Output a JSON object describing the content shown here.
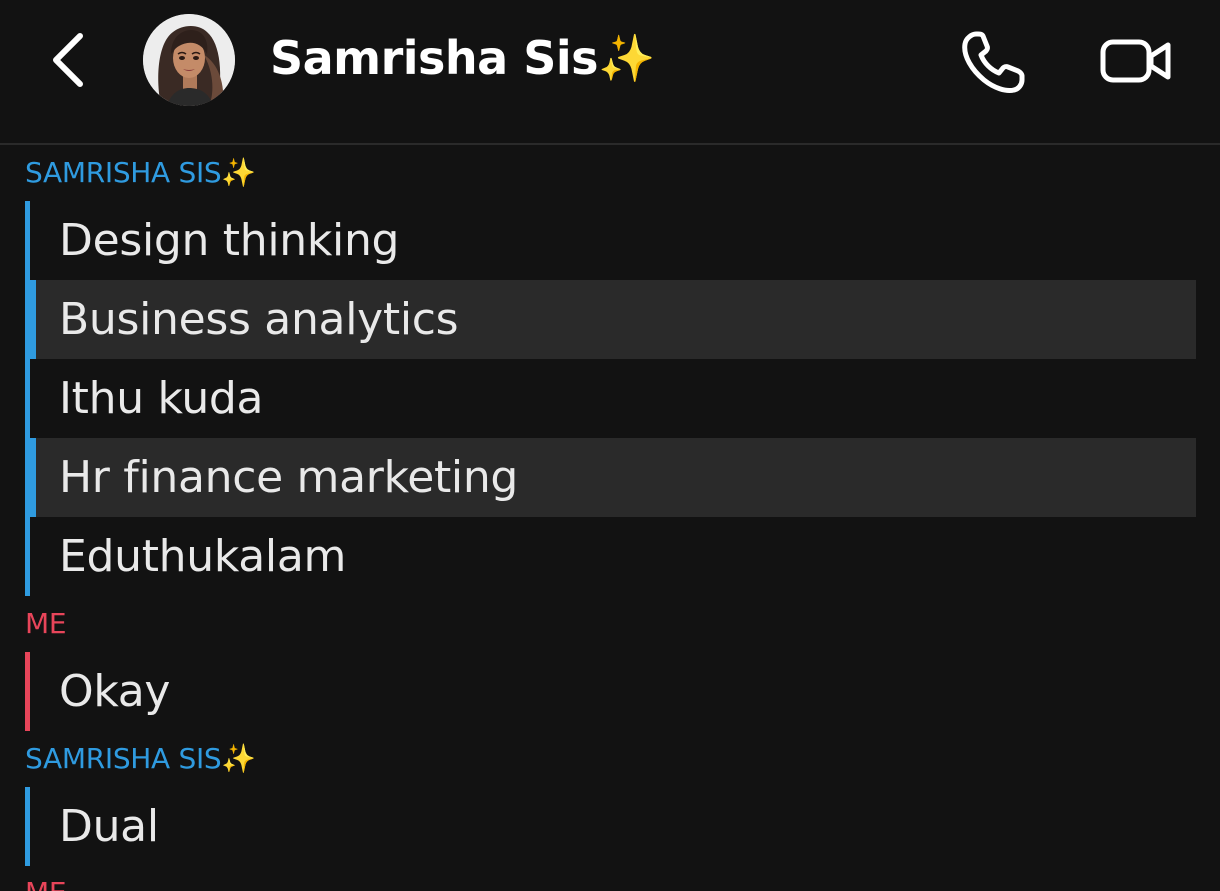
{
  "header": {
    "contact_name": "Samrisha Sis✨",
    "back_icon": "chevron-left-icon",
    "call_icon": "phone-icon",
    "video_icon": "video-camera-icon"
  },
  "colors": {
    "background": "#121212",
    "them_accent": "#2f9be0",
    "me_accent": "#e8455a",
    "highlight_bg": "#2a2a2a",
    "text": "#e9e9e9"
  },
  "conversation": [
    {
      "sender": "SAMRISHA SIS✨",
      "side": "them",
      "messages": [
        {
          "text": "Design thinking",
          "highlighted": false
        },
        {
          "text": "Business analytics",
          "highlighted": true
        },
        {
          "text": "Ithu kuda",
          "highlighted": false
        },
        {
          "text": "Hr finance marketing",
          "highlighted": true
        },
        {
          "text": "Eduthukalam",
          "highlighted": false
        }
      ]
    },
    {
      "sender": "ME",
      "side": "me",
      "messages": [
        {
          "text": "Okay",
          "highlighted": false
        }
      ]
    },
    {
      "sender": "SAMRISHA SIS✨",
      "side": "them",
      "messages": [
        {
          "text": "Dual",
          "highlighted": false
        }
      ]
    },
    {
      "sender": "ME",
      "side": "me",
      "messages": []
    }
  ]
}
